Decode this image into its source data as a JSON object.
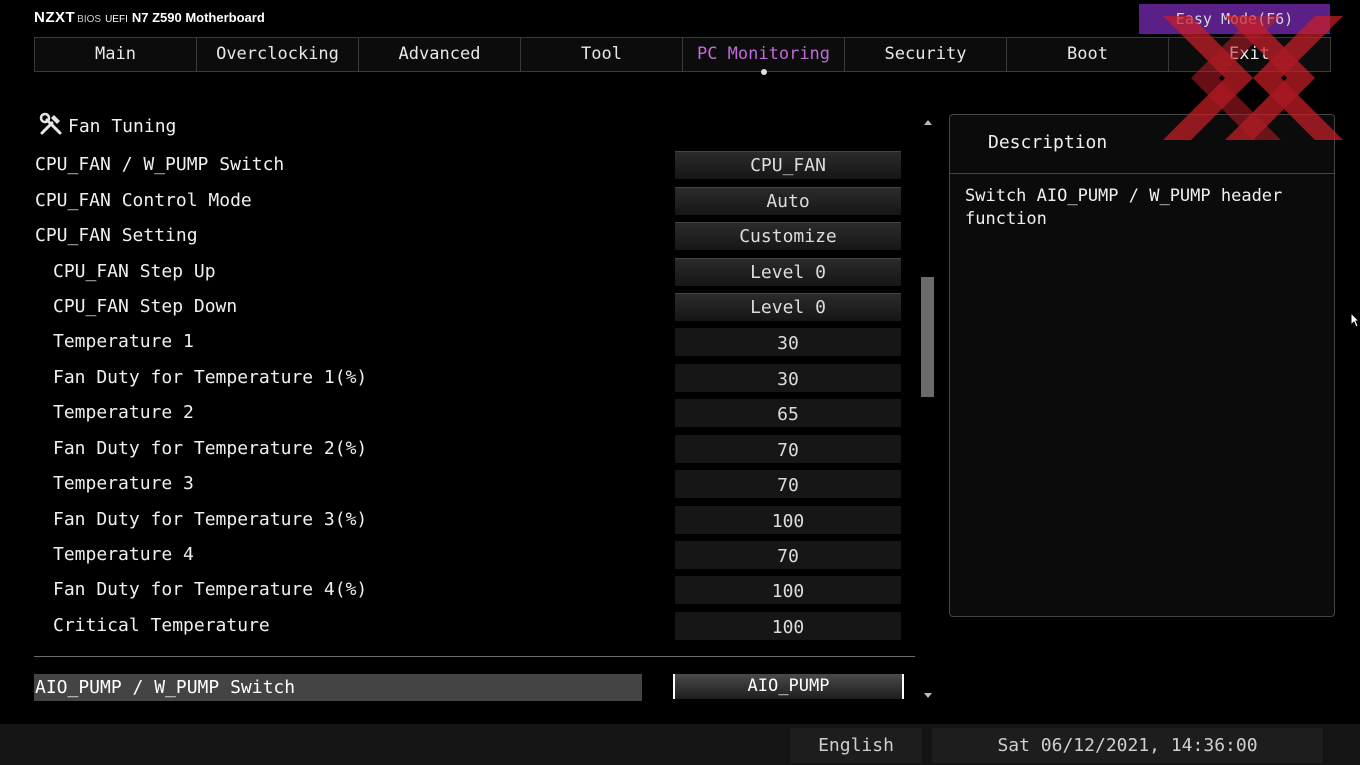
{
  "header": {
    "logo": "NZXT",
    "bios": "BIOS",
    "uefi": "UEFI",
    "model": "N7 Z590 Motherboard",
    "easy_mode_label": "Easy Mode(F6)"
  },
  "tabs": [
    {
      "label": "Main",
      "active": false
    },
    {
      "label": "Overclocking",
      "active": false
    },
    {
      "label": "Advanced",
      "active": false
    },
    {
      "label": "Tool",
      "active": false
    },
    {
      "label": "PC Monitoring",
      "active": true
    },
    {
      "label": "Security",
      "active": false
    },
    {
      "label": "Boot",
      "active": false
    },
    {
      "label": "Exit",
      "active": false
    }
  ],
  "section": {
    "title": "Fan Tuning",
    "icon": "tools-icon"
  },
  "settings": [
    {
      "label": "CPU_FAN / W_PUMP Switch",
      "value": "CPU_FAN"
    },
    {
      "label": "CPU_FAN Control Mode",
      "value": "Auto"
    },
    {
      "label": "CPU_FAN Setting",
      "value": "Customize"
    },
    {
      "label": "CPU_FAN Step Up",
      "value": "Level 0"
    },
    {
      "label": "CPU_FAN Step Down",
      "value": "Level 0"
    },
    {
      "label": "Temperature 1",
      "value": "30"
    },
    {
      "label": "Fan Duty for Temperature 1(%)",
      "value": "30"
    },
    {
      "label": "Temperature 2",
      "value": "65"
    },
    {
      "label": "Fan Duty for Temperature 2(%)",
      "value": "70"
    },
    {
      "label": "Temperature 3",
      "value": "70"
    },
    {
      "label": "Fan Duty for Temperature 3(%)",
      "value": "100"
    },
    {
      "label": "Temperature 4",
      "value": "70"
    },
    {
      "label": "Fan Duty for Temperature 4(%)",
      "value": "100"
    },
    {
      "label": "Critical Temperature",
      "value": "100"
    }
  ],
  "selected": {
    "label": "AIO_PUMP / W_PUMP Switch",
    "value": "AIO_PUMP"
  },
  "description": {
    "title": "Description",
    "text": "Switch AIO_PUMP / W_PUMP header function"
  },
  "status": {
    "language": "English",
    "datetime": "Sat 06/12/2021, 14:36:00"
  },
  "colors": {
    "accent": "#c06bd8",
    "easy_mode_bg": "#5b1f88",
    "watermark": "#d0202a"
  }
}
